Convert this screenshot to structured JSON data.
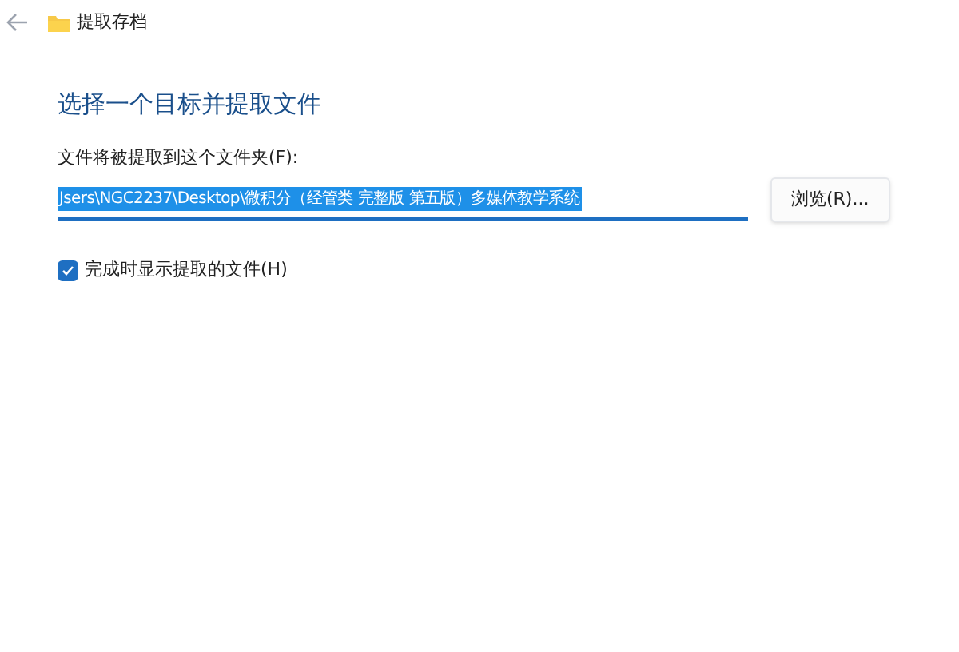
{
  "window": {
    "title": "提取存档"
  },
  "heading": "选择一个目标并提取文件",
  "destination": {
    "label": "文件将被提取到这个文件夹(F):",
    "value": "Jsers\\NGC2237\\Desktop\\微积分（经管类 完整版 第五版）多媒体教学系统",
    "text_selected": true
  },
  "browse_button": "浏览(R)...",
  "show_files": {
    "label": "完成时显示提取的文件(H)",
    "checked": true
  }
}
